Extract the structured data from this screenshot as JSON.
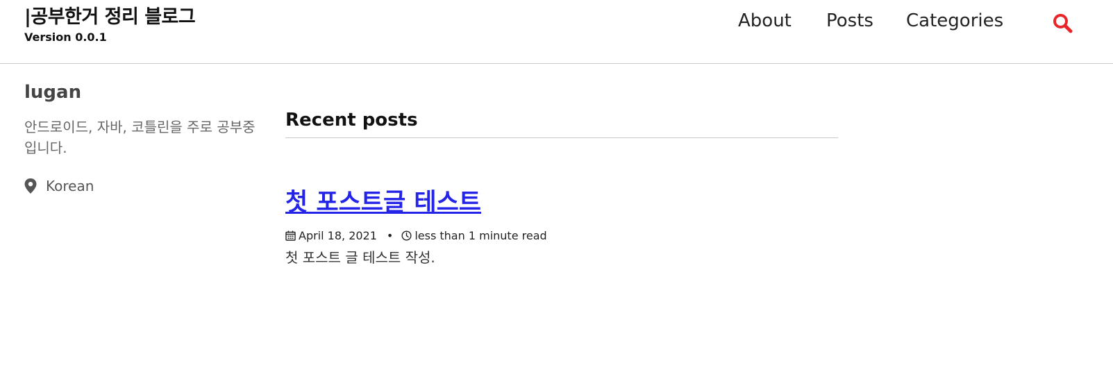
{
  "header": {
    "site_title": "|공부한거 정리 블로그",
    "subtitle": "Version 0.0.1",
    "nav": [
      {
        "label": "About"
      },
      {
        "label": "Posts"
      },
      {
        "label": "Categories"
      }
    ],
    "search_icon": "search-icon",
    "accent_color": "#e8262a"
  },
  "sidebar": {
    "author_name": "lugan",
    "bio": "안드로이드, 자바, 코틀린을 주로 공부중입니다.",
    "location_icon": "map-marker-icon",
    "location": "Korean"
  },
  "main": {
    "section_title": "Recent posts",
    "posts": [
      {
        "title": "첫 포스트글 테스트",
        "date": "April 18, 2021",
        "separator": "•",
        "read_time": "less than 1 minute read",
        "excerpt": "첫 포스트 글 테스트 작성.",
        "link_color": "#2424e8"
      }
    ]
  }
}
